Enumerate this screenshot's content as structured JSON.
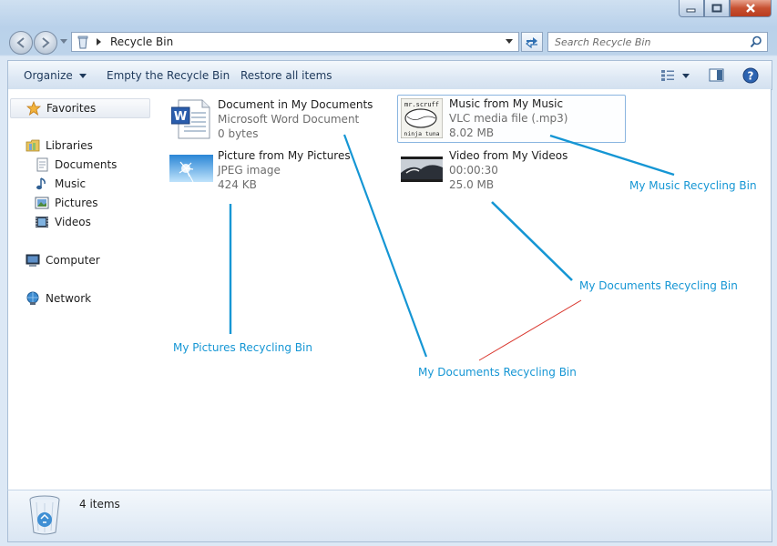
{
  "window": {
    "title": "Recycle Bin",
    "address_path": "Recycle Bin",
    "search_placeholder": "Search Recycle Bin"
  },
  "toolbar": {
    "organize_label": "Organize",
    "empty_label": "Empty the Recycle Bin",
    "restore_label": "Restore all items"
  },
  "sidebar": {
    "favorites": "Favorites",
    "libraries": "Libraries",
    "documents": "Documents",
    "music": "Music",
    "pictures": "Pictures",
    "videos": "Videos",
    "computer": "Computer",
    "network": "Network"
  },
  "files": [
    {
      "name": "Document in My Documents",
      "line1": "Microsoft Word Document",
      "line2": "0 bytes",
      "icon": "word-document-icon"
    },
    {
      "name": "Music from My Music",
      "line1": "VLC media file (.mp3)",
      "line2": "8.02 MB",
      "icon": "album-art-thumbnail",
      "art_text_1": "mr.scruff",
      "art_text_2": "ninja tuna"
    },
    {
      "name": "Picture from My Pictures",
      "line1": "JPEG image",
      "line2": "424 KB",
      "icon": "picture-thumbnail"
    },
    {
      "name": "Video from My Videos",
      "line1": "00:00:30",
      "line2": "25.0 MB",
      "icon": "video-thumbnail"
    }
  ],
  "annotations": {
    "music_bin": "My Music Recycling Bin",
    "documents_bin_right": "My Documents Recycling Bin",
    "pictures_bin": "My Pictures Recycling Bin",
    "documents_bin_bottom": "My Documents Recycling Bin"
  },
  "status": {
    "item_count": "4 items"
  },
  "colors": {
    "annotation": "#1596d4",
    "annotation_red_line": "#d9342b",
    "toolbar_text": "#1e395b"
  }
}
